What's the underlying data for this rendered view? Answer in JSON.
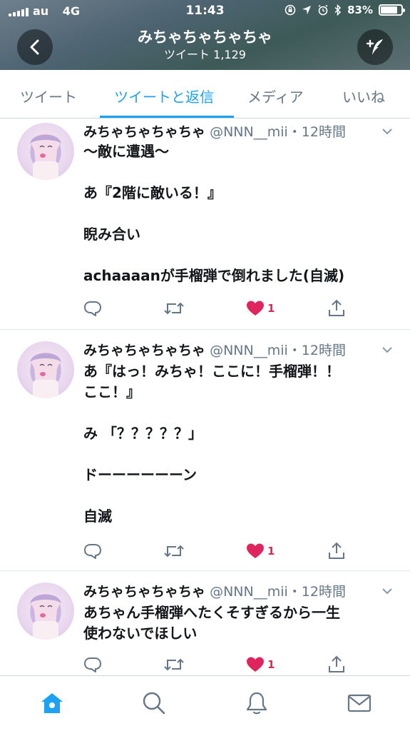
{
  "status_bar": {
    "carrier": "au",
    "network": "4G",
    "time": "11:43",
    "battery": "83%",
    "battery_level": 0.83
  },
  "header": {
    "title": "みちゃちゃちゃちゃ",
    "tweet_count": "ツイート 1,129"
  },
  "tabs": [
    {
      "label": "ツイート"
    },
    {
      "label": "ツイートと返信"
    },
    {
      "label": "メディア"
    },
    {
      "label": "いいね"
    }
  ],
  "active_tab": 1,
  "tweets": [
    {
      "name": "みちゃちゃちゃちゃ",
      "meta": "@NNN__mii・12時間",
      "lines": [
        "〜敵に遭遇〜",
        "",
        "あ『2階に敵いる！』",
        "",
        "睨み合い",
        "",
        "achaaaanが手榴弾で倒れました(自滅)"
      ],
      "likes": "1"
    },
    {
      "name": "みちゃちゃちゃちゃ",
      "meta": "@NNN__mii・12時間",
      "lines": [
        "あ『はっ！みちゃ！ここに！手榴弾！！",
        "ここ！』",
        "",
        "み 「？？？？？」",
        "",
        "ドーーーーーーン",
        "",
        "自滅"
      ],
      "likes": "1"
    },
    {
      "name": "みちゃちゃちゃちゃ",
      "meta": "@NNN__mii・12時間",
      "lines": [
        "あちゃん手榴弾へたくそすぎるから一生",
        "使わないでほしい"
      ],
      "likes": "1"
    }
  ],
  "colors": {
    "accent": "#1da1f2",
    "like": "#e0245e",
    "secondary_text": "#657786"
  },
  "icons": {
    "back": "chevron-left-icon",
    "compose": "quill-plus-icon",
    "reply": "reply-icon",
    "retweet": "retweet-icon",
    "like": "heart-icon",
    "share": "share-icon",
    "home": "home-icon",
    "search": "search-icon",
    "notifications": "bell-icon",
    "messages": "envelope-icon"
  }
}
